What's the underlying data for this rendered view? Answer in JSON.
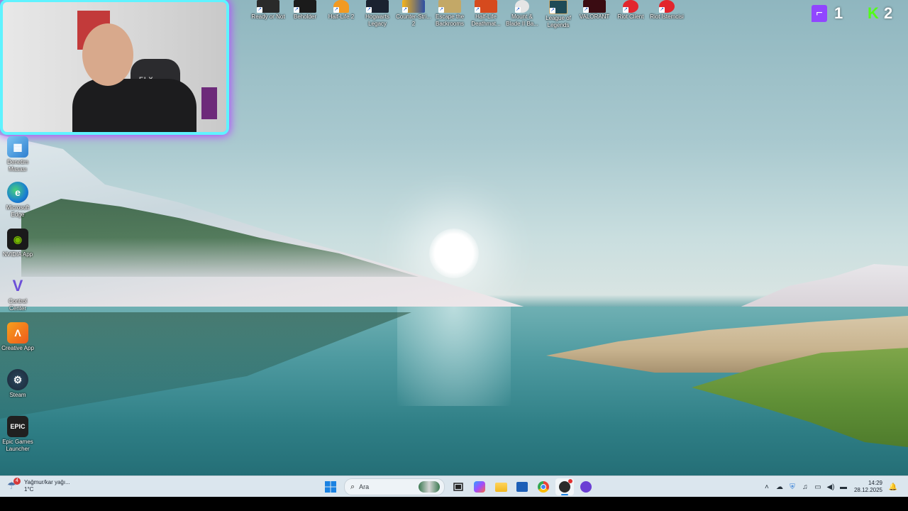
{
  "top_icons": [
    {
      "label": "Ready or Not",
      "icon": "ready-or-not-icon",
      "color": "#2a2a2a"
    },
    {
      "label": "Beholder",
      "icon": "beholder-icon",
      "color": "#1b1b1b"
    },
    {
      "label": "Half-Life 2",
      "icon": "half-life-2-icon",
      "color": "#f29a22"
    },
    {
      "label": "Hogwarts Legacy",
      "icon": "hogwarts-legacy-icon",
      "color": "#1a2230"
    },
    {
      "label": "Counter-Stri... 2",
      "icon": "counter-strike-2-icon",
      "color": "#f5b31a"
    },
    {
      "label": "Escape the Backrooms",
      "icon": "escape-backrooms-icon",
      "color": "#c3a867"
    },
    {
      "label": "Half-Life Deathmat...",
      "icon": "half-life-deathmatch-icon",
      "color": "#d64a1e"
    },
    {
      "label": "Mount & Blade II Ba...",
      "icon": "mount-blade-icon",
      "color": "#d9d9d9"
    },
    {
      "label": "League of Legends",
      "icon": "league-of-legends-icon",
      "color": "#1e4b57"
    },
    {
      "label": "VALORANT",
      "icon": "valorant-icon",
      "color": "#ff4655"
    },
    {
      "label": "Riot Client",
      "icon": "riot-client-icon",
      "color": "#e2262e"
    },
    {
      "label": "Riot İstemcisi",
      "icon": "riot-client-icon",
      "color": "#e2262e"
    }
  ],
  "left_icons": [
    {
      "label": "Denetim Masası",
      "icon": "control-panel-icon",
      "color": "#3a8ed8",
      "glyph": "▦"
    },
    {
      "label": "Microsoft Edge",
      "icon": "edge-icon",
      "color": "#1a7fd2",
      "glyph": "e"
    },
    {
      "label": "NVIDIA App",
      "icon": "nvidia-icon",
      "color": "#76b900",
      "glyph": "◉"
    },
    {
      "label": "Control Center",
      "icon": "control-center-icon",
      "color": "#6c4fd8",
      "glyph": "V"
    },
    {
      "label": "Creative App",
      "icon": "creative-app-icon",
      "color": "#f07a18",
      "glyph": "Λ"
    },
    {
      "label": "Steam",
      "icon": "steam-icon",
      "color": "#1b2838",
      "glyph": "⚙"
    },
    {
      "label": "Epic Games Launcher",
      "icon": "epic-games-icon",
      "color": "#202020",
      "glyph": "EPIC"
    }
  ],
  "counters": {
    "twitch": {
      "value": "1",
      "icon": "twitch-icon",
      "color": "#9146ff",
      "glyph": "t"
    },
    "kick": {
      "value": "2",
      "icon": "kick-icon",
      "color": "#53fc18",
      "glyph": "K"
    }
  },
  "webcam": {
    "chair_label": "ELX"
  },
  "taskbar": {
    "weather": {
      "badge": "4",
      "condition": "Yağmur/kar yağı...",
      "temp": "1°C"
    },
    "search_placeholder": "Ara",
    "clock": {
      "time": "14:29",
      "date": "28.12.2025"
    }
  },
  "colors": {
    "accent_cyan": "#5ff3ff",
    "accent_purple": "#b34dff",
    "taskbar_bg": "#dbe6ee"
  }
}
